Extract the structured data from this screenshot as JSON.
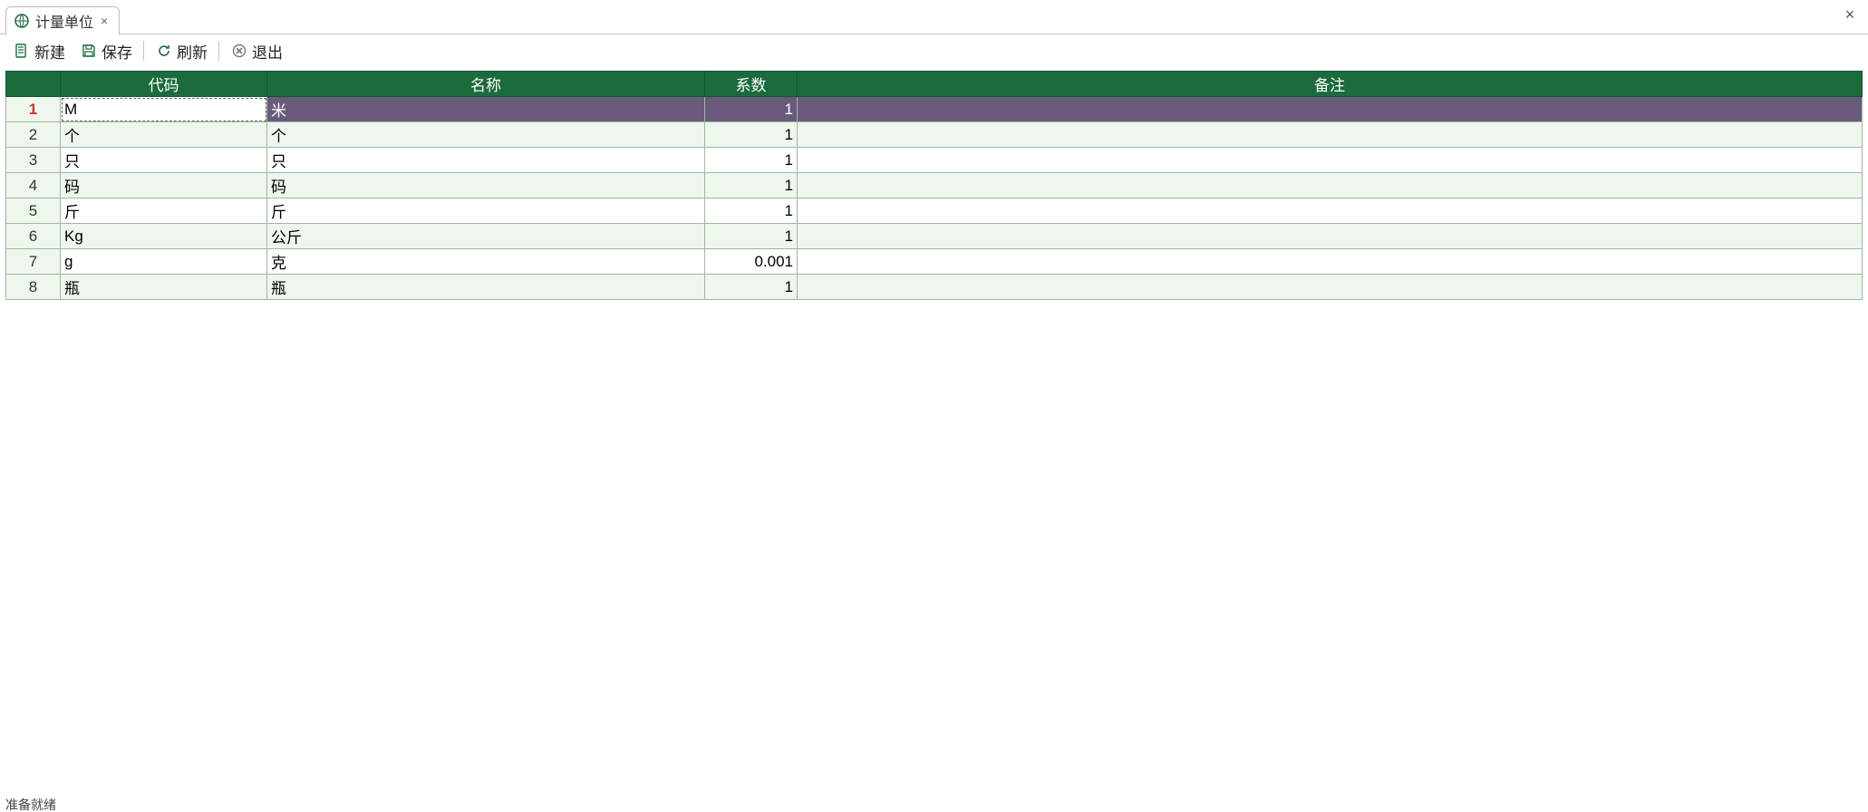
{
  "tab": {
    "title": "计量单位"
  },
  "toolbar": {
    "new_label": "新建",
    "save_label": "保存",
    "refresh_label": "刷新",
    "exit_label": "退出"
  },
  "grid": {
    "columns": {
      "code": "代码",
      "name": "名称",
      "factor": "系数",
      "remark": "备注"
    },
    "selected_row_index": 0,
    "editing_col": "code",
    "rows": [
      {
        "num": "1",
        "code": "M",
        "name": "米",
        "factor": "1",
        "remark": ""
      },
      {
        "num": "2",
        "code": "个",
        "name": "个",
        "factor": "1",
        "remark": ""
      },
      {
        "num": "3",
        "code": "只",
        "name": "只",
        "factor": "1",
        "remark": ""
      },
      {
        "num": "4",
        "code": "码",
        "name": "码",
        "factor": "1",
        "remark": ""
      },
      {
        "num": "5",
        "code": "斤",
        "name": "斤",
        "factor": "1",
        "remark": ""
      },
      {
        "num": "6",
        "code": "Kg",
        "name": "公斤",
        "factor": "1",
        "remark": ""
      },
      {
        "num": "7",
        "code": "g",
        "name": "克",
        "factor": "0.001",
        "remark": ""
      },
      {
        "num": "8",
        "code": "瓶",
        "name": "瓶",
        "factor": "1",
        "remark": ""
      }
    ]
  },
  "status": {
    "text": "准备就绪"
  }
}
